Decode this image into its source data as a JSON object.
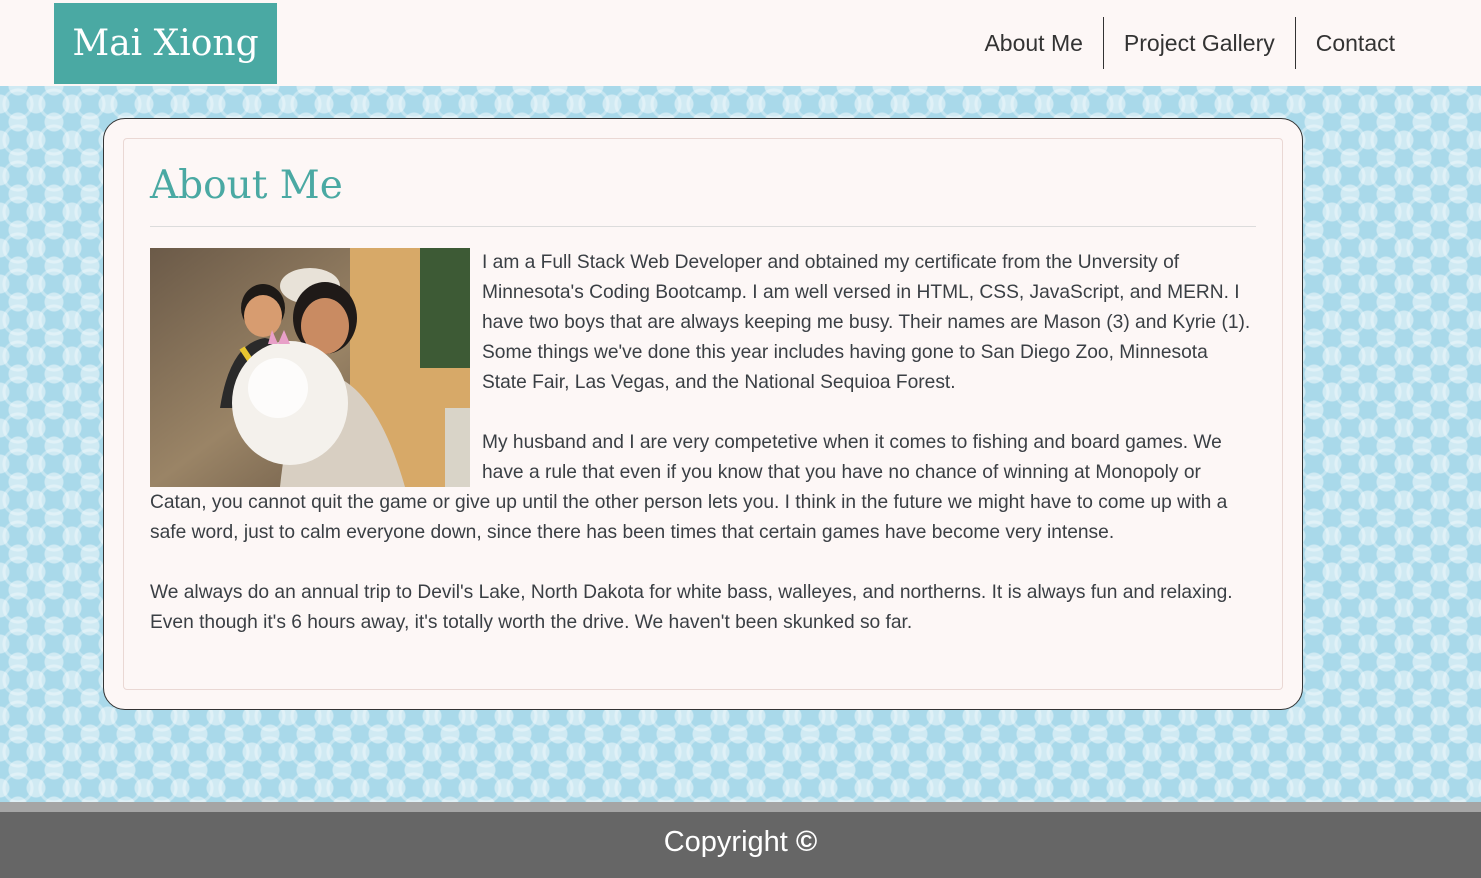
{
  "header": {
    "brand": "Mai Xiong",
    "nav": [
      {
        "label": "About Me"
      },
      {
        "label": "Project Gallery"
      },
      {
        "label": "Contact"
      }
    ]
  },
  "about": {
    "heading": "About Me",
    "paragraphs": [
      "I am a Full Stack Web Developer and obtained my certificate from the Unversity of Minnesota's Coding Bootcamp. I am well versed in HTML, CSS, JavaScript, and MERN. I have two boys that are always keeping me busy. Their names are Mason (3) and Kyrie (1). Some things we've done this year includes having gone to San Diego Zoo, Minnesota State Fair, Las Vegas, and the National Sequioa Forest.",
      "My husband and I are very competetive when it comes to fishing and board games. We have a rule that even if you know that you have no chance of winning at Monopoly or Catan, you cannot quit the game or give up until the other person lets you. I think in the future we might have to come up with a safe word, just to calm everyone down, since there has been times that certain games have become very intense.",
      "We always do an annual trip to Devil's Lake, North Dakota for white bass, walleyes, and northerns. It is always fun and relaxing. Even though it's 6 hours away, it's totally worth the drive. We haven't been skunked so far."
    ]
  },
  "footer": {
    "copyright": "Copyright"
  },
  "colors": {
    "accent": "#4aa9a3",
    "footer": "#666666",
    "background": "#a9d9ea"
  }
}
